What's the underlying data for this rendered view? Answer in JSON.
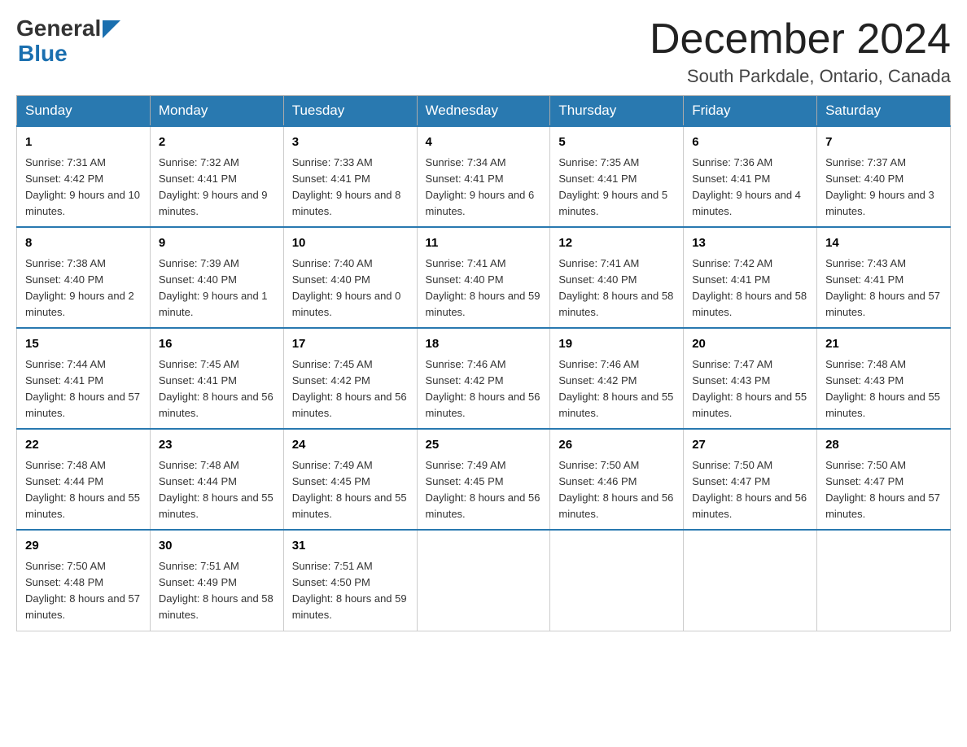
{
  "header": {
    "logo_general": "General",
    "logo_blue": "Blue",
    "month_title": "December 2024",
    "location": "South Parkdale, Ontario, Canada"
  },
  "days_of_week": [
    "Sunday",
    "Monday",
    "Tuesday",
    "Wednesday",
    "Thursday",
    "Friday",
    "Saturday"
  ],
  "weeks": [
    [
      {
        "day": "1",
        "sunrise": "7:31 AM",
        "sunset": "4:42 PM",
        "daylight": "9 hours and 10 minutes."
      },
      {
        "day": "2",
        "sunrise": "7:32 AM",
        "sunset": "4:41 PM",
        "daylight": "9 hours and 9 minutes."
      },
      {
        "day": "3",
        "sunrise": "7:33 AM",
        "sunset": "4:41 PM",
        "daylight": "9 hours and 8 minutes."
      },
      {
        "day": "4",
        "sunrise": "7:34 AM",
        "sunset": "4:41 PM",
        "daylight": "9 hours and 6 minutes."
      },
      {
        "day": "5",
        "sunrise": "7:35 AM",
        "sunset": "4:41 PM",
        "daylight": "9 hours and 5 minutes."
      },
      {
        "day": "6",
        "sunrise": "7:36 AM",
        "sunset": "4:41 PM",
        "daylight": "9 hours and 4 minutes."
      },
      {
        "day": "7",
        "sunrise": "7:37 AM",
        "sunset": "4:40 PM",
        "daylight": "9 hours and 3 minutes."
      }
    ],
    [
      {
        "day": "8",
        "sunrise": "7:38 AM",
        "sunset": "4:40 PM",
        "daylight": "9 hours and 2 minutes."
      },
      {
        "day": "9",
        "sunrise": "7:39 AM",
        "sunset": "4:40 PM",
        "daylight": "9 hours and 1 minute."
      },
      {
        "day": "10",
        "sunrise": "7:40 AM",
        "sunset": "4:40 PM",
        "daylight": "9 hours and 0 minutes."
      },
      {
        "day": "11",
        "sunrise": "7:41 AM",
        "sunset": "4:40 PM",
        "daylight": "8 hours and 59 minutes."
      },
      {
        "day": "12",
        "sunrise": "7:41 AM",
        "sunset": "4:40 PM",
        "daylight": "8 hours and 58 minutes."
      },
      {
        "day": "13",
        "sunrise": "7:42 AM",
        "sunset": "4:41 PM",
        "daylight": "8 hours and 58 minutes."
      },
      {
        "day": "14",
        "sunrise": "7:43 AM",
        "sunset": "4:41 PM",
        "daylight": "8 hours and 57 minutes."
      }
    ],
    [
      {
        "day": "15",
        "sunrise": "7:44 AM",
        "sunset": "4:41 PM",
        "daylight": "8 hours and 57 minutes."
      },
      {
        "day": "16",
        "sunrise": "7:45 AM",
        "sunset": "4:41 PM",
        "daylight": "8 hours and 56 minutes."
      },
      {
        "day": "17",
        "sunrise": "7:45 AM",
        "sunset": "4:42 PM",
        "daylight": "8 hours and 56 minutes."
      },
      {
        "day": "18",
        "sunrise": "7:46 AM",
        "sunset": "4:42 PM",
        "daylight": "8 hours and 56 minutes."
      },
      {
        "day": "19",
        "sunrise": "7:46 AM",
        "sunset": "4:42 PM",
        "daylight": "8 hours and 55 minutes."
      },
      {
        "day": "20",
        "sunrise": "7:47 AM",
        "sunset": "4:43 PM",
        "daylight": "8 hours and 55 minutes."
      },
      {
        "day": "21",
        "sunrise": "7:48 AM",
        "sunset": "4:43 PM",
        "daylight": "8 hours and 55 minutes."
      }
    ],
    [
      {
        "day": "22",
        "sunrise": "7:48 AM",
        "sunset": "4:44 PM",
        "daylight": "8 hours and 55 minutes."
      },
      {
        "day": "23",
        "sunrise": "7:48 AM",
        "sunset": "4:44 PM",
        "daylight": "8 hours and 55 minutes."
      },
      {
        "day": "24",
        "sunrise": "7:49 AM",
        "sunset": "4:45 PM",
        "daylight": "8 hours and 55 minutes."
      },
      {
        "day": "25",
        "sunrise": "7:49 AM",
        "sunset": "4:45 PM",
        "daylight": "8 hours and 56 minutes."
      },
      {
        "day": "26",
        "sunrise": "7:50 AM",
        "sunset": "4:46 PM",
        "daylight": "8 hours and 56 minutes."
      },
      {
        "day": "27",
        "sunrise": "7:50 AM",
        "sunset": "4:47 PM",
        "daylight": "8 hours and 56 minutes."
      },
      {
        "day": "28",
        "sunrise": "7:50 AM",
        "sunset": "4:47 PM",
        "daylight": "8 hours and 57 minutes."
      }
    ],
    [
      {
        "day": "29",
        "sunrise": "7:50 AM",
        "sunset": "4:48 PM",
        "daylight": "8 hours and 57 minutes."
      },
      {
        "day": "30",
        "sunrise": "7:51 AM",
        "sunset": "4:49 PM",
        "daylight": "8 hours and 58 minutes."
      },
      {
        "day": "31",
        "sunrise": "7:51 AM",
        "sunset": "4:50 PM",
        "daylight": "8 hours and 59 minutes."
      },
      null,
      null,
      null,
      null
    ]
  ]
}
